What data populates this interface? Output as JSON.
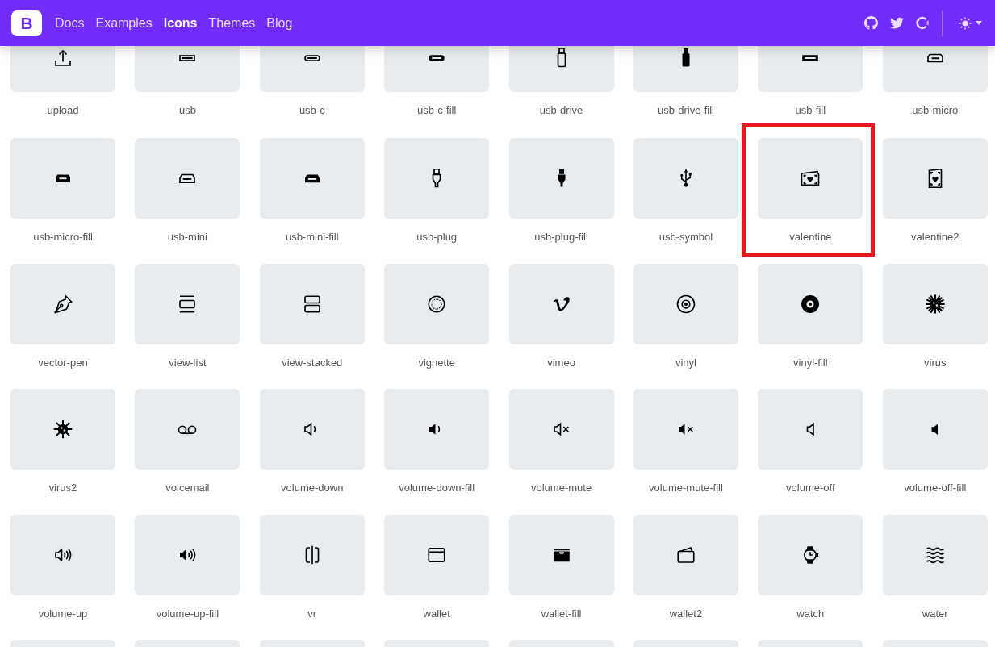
{
  "navbar": {
    "logo": "B",
    "links": [
      {
        "label": "Docs",
        "selected": false
      },
      {
        "label": "Examples",
        "selected": false
      },
      {
        "label": "Icons",
        "selected": true
      },
      {
        "label": "Themes",
        "selected": false
      },
      {
        "label": "Blog",
        "selected": false
      }
    ]
  },
  "icons": [
    {
      "name": "upload",
      "highlighted": false
    },
    {
      "name": "usb",
      "highlighted": false
    },
    {
      "name": "usb-c",
      "highlighted": false
    },
    {
      "name": "usb-c-fill",
      "highlighted": false
    },
    {
      "name": "usb-drive",
      "highlighted": false
    },
    {
      "name": "usb-drive-fill",
      "highlighted": false
    },
    {
      "name": "usb-fill",
      "highlighted": false
    },
    {
      "name": "usb-micro",
      "highlighted": false
    },
    {
      "name": "usb-micro-fill",
      "highlighted": false
    },
    {
      "name": "usb-mini",
      "highlighted": false
    },
    {
      "name": "usb-mini-fill",
      "highlighted": false
    },
    {
      "name": "usb-plug",
      "highlighted": false
    },
    {
      "name": "usb-plug-fill",
      "highlighted": false
    },
    {
      "name": "usb-symbol",
      "highlighted": false
    },
    {
      "name": "valentine",
      "highlighted": true
    },
    {
      "name": "valentine2",
      "highlighted": false
    },
    {
      "name": "vector-pen",
      "highlighted": false
    },
    {
      "name": "view-list",
      "highlighted": false
    },
    {
      "name": "view-stacked",
      "highlighted": false
    },
    {
      "name": "vignette",
      "highlighted": false
    },
    {
      "name": "vimeo",
      "highlighted": false
    },
    {
      "name": "vinyl",
      "highlighted": false
    },
    {
      "name": "vinyl-fill",
      "highlighted": false
    },
    {
      "name": "virus",
      "highlighted": false
    },
    {
      "name": "virus2",
      "highlighted": false
    },
    {
      "name": "voicemail",
      "highlighted": false
    },
    {
      "name": "volume-down",
      "highlighted": false
    },
    {
      "name": "volume-down-fill",
      "highlighted": false
    },
    {
      "name": "volume-mute",
      "highlighted": false
    },
    {
      "name": "volume-mute-fill",
      "highlighted": false
    },
    {
      "name": "volume-off",
      "highlighted": false
    },
    {
      "name": "volume-off-fill",
      "highlighted": false
    },
    {
      "name": "volume-up",
      "highlighted": false
    },
    {
      "name": "volume-up-fill",
      "highlighted": false
    },
    {
      "name": "vr",
      "highlighted": false
    },
    {
      "name": "wallet",
      "highlighted": false
    },
    {
      "name": "wallet-fill",
      "highlighted": false
    },
    {
      "name": "wallet2",
      "highlighted": false
    },
    {
      "name": "watch",
      "highlighted": false
    },
    {
      "name": "water",
      "highlighted": false
    }
  ]
}
